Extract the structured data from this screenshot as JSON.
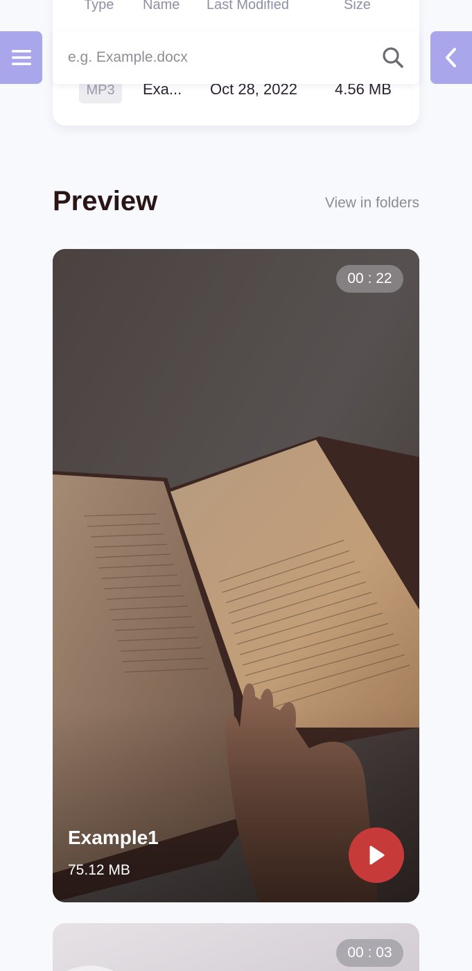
{
  "table": {
    "headers": [
      "Type",
      "Name",
      "Last Modified",
      "Size"
    ],
    "row": {
      "type": "MP3",
      "name": "Exa...",
      "modified": "Oct 28, 2022",
      "size": "4.56 MB"
    }
  },
  "search": {
    "placeholder": "e.g. Example.docx",
    "icon": "search-icon"
  },
  "nav": {
    "menu_icon": "hamburger-icon",
    "back_icon": "chevron-left-icon"
  },
  "preview": {
    "title": "Preview",
    "view_link": "View in folders",
    "cards": [
      {
        "duration": "00 : 22",
        "name": "Example1",
        "size": "75.12 MB"
      },
      {
        "duration": "00 : 03"
      }
    ]
  },
  "colors": {
    "accent": "#a9a6ec",
    "play": "#c73a3a",
    "background": "#f8f9fd"
  }
}
